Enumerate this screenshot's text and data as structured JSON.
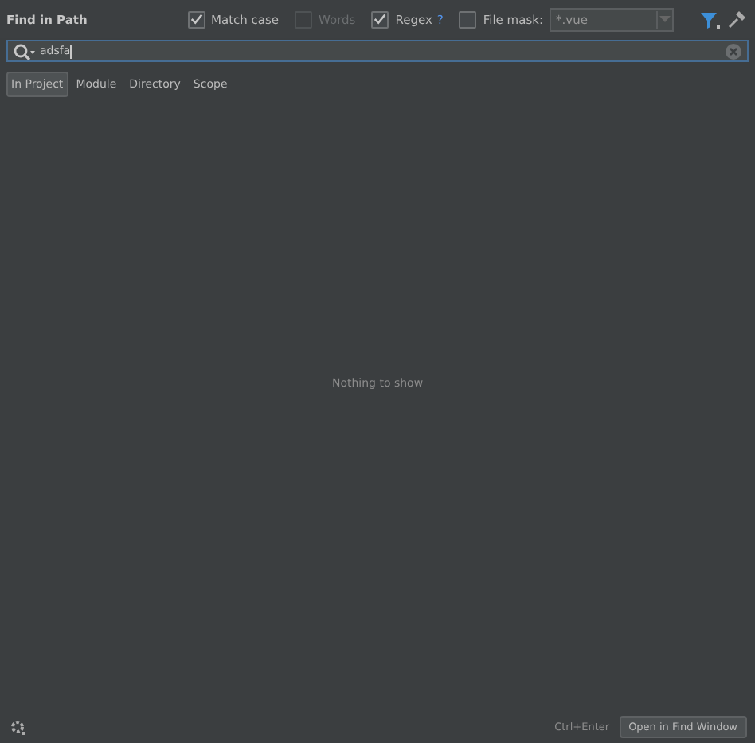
{
  "window": {
    "title": "Find in Path"
  },
  "options": [
    {
      "label": "Match case",
      "checked": true
    },
    {
      "label": "Words",
      "checked": false,
      "disabled": true
    },
    {
      "label": "Regex",
      "checked": true,
      "help": "?"
    },
    {
      "label": "File mask:",
      "checked": false
    }
  ],
  "file_mask": {
    "value": "*.vue"
  },
  "search": {
    "value": "adsfa"
  },
  "scopes": [
    {
      "label": "In Project",
      "selected": true
    },
    {
      "label": "Module",
      "selected": false
    },
    {
      "label": "Directory",
      "selected": false
    },
    {
      "label": "Scope",
      "selected": false
    }
  ],
  "results": {
    "empty_text": "Nothing to show"
  },
  "footer": {
    "shortcut": "Ctrl+Enter",
    "button": "Open in Find Window"
  }
}
